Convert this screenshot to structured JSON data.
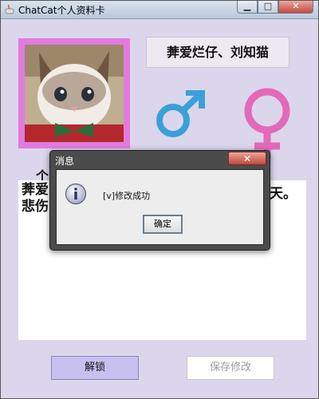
{
  "window": {
    "title": "ChatCat个人资料卡",
    "min_symbol": "▁",
    "max_symbol": "□",
    "close_symbol": "✕"
  },
  "profile": {
    "name": "莾爱烂仔、刘知猫",
    "avatar_icon": "cat-avatar-photo",
    "gender_icons": [
      "male-symbol-icon",
      "female-symbol-icon"
    ],
    "male_color": "#3aa0d8",
    "female_color": "#e26ab8",
    "signature_label": "个",
    "signature_lines": [
      "莾爱",
      "悲伤"
    ],
    "signature_tail": "天。"
  },
  "buttons": {
    "unlock_label": "解锁",
    "save_label": "保存修改"
  },
  "dialog": {
    "title": "消息",
    "close_symbol": "✕",
    "message": "[v]修改成功",
    "ok_label": "确定"
  },
  "colors": {
    "window_bg": "#dcd6ec",
    "avatar_frame": "#e27be0",
    "unlock_bg": "#c8c0ee"
  }
}
